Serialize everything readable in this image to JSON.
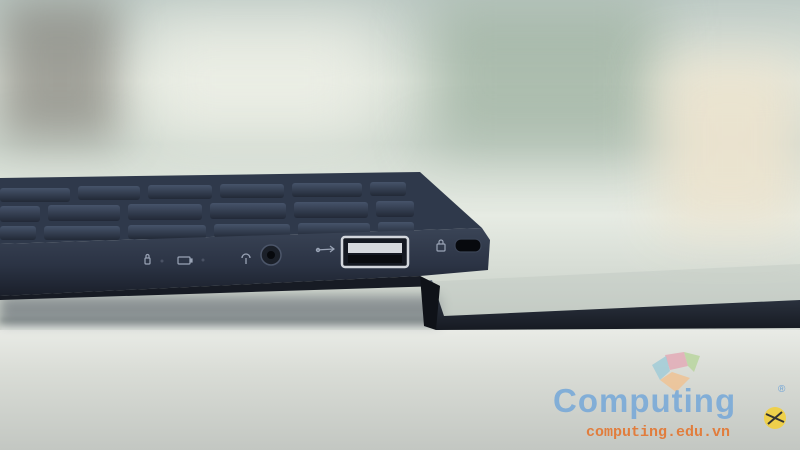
{
  "watermark": {
    "brand": "Computing",
    "url": "computing.edu.vn",
    "brand_color": "#6fa3d6",
    "url_color": "#e06a2b"
  },
  "colors": {
    "laptop_body": "#2b3344",
    "lid": "#1f2530"
  },
  "icons": {
    "led": "lock-icon",
    "battery": "battery-icon",
    "audio": "headphone-icon",
    "usb": "usb-icon",
    "security": "kensington-lock-icon"
  }
}
